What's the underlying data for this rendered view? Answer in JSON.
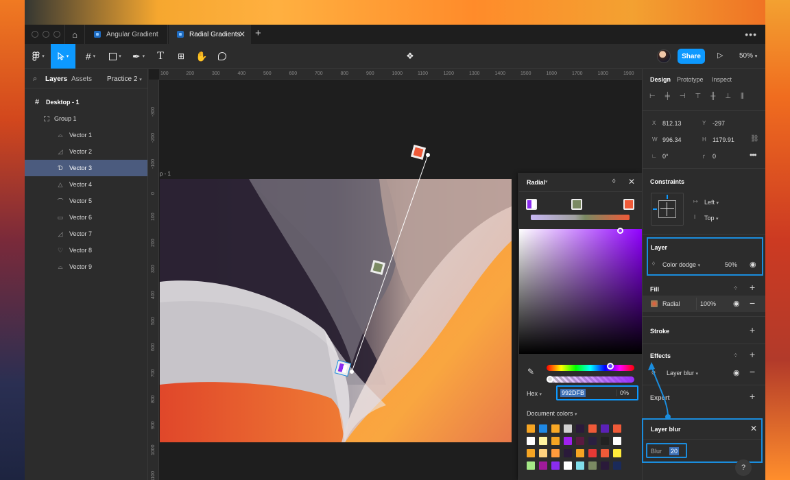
{
  "titlebar": {
    "tabs": [
      {
        "label": "Angular Gradient"
      },
      {
        "label": "Radial Gradients"
      }
    ],
    "close": "✕",
    "new_tab": "+",
    "more": "•••"
  },
  "toolbar": {
    "share_label": "Share",
    "zoom": "50%",
    "accent": "#0d99ff"
  },
  "layers_panel": {
    "tabs": {
      "layers": "Layers",
      "assets": "Assets",
      "page": "Practice 2"
    },
    "frame": "Desktop - 1",
    "group": "Group 1",
    "items": [
      "Vector 1",
      "Vector 2",
      "Vector 3",
      "Vector 4",
      "Vector 5",
      "Vector 6",
      "Vector 7",
      "Vector 8",
      "Vector 9"
    ],
    "selected": "Vector 3"
  },
  "canvas": {
    "frame_label": "p - 1",
    "ruler_h": [
      "100",
      "200",
      "300",
      "400",
      "500",
      "600",
      "700",
      "800",
      "900",
      "1000",
      "1100",
      "1200",
      "1300",
      "1400",
      "1500",
      "1600",
      "1700",
      "1800",
      "1900"
    ],
    "ruler_v": [
      "-300",
      "-200",
      "-100",
      "0",
      "100",
      "200",
      "300",
      "400",
      "500",
      "600",
      "700",
      "800",
      "900",
      "1000",
      "1100"
    ]
  },
  "picker": {
    "type": "Radial",
    "hex_label": "Hex",
    "hex_value": "992DFB",
    "opacity": "0%",
    "doc_colors_label": "Document colors",
    "stops": [
      "#8a2cf0",
      "#7b8a63",
      "#ef5a38"
    ],
    "swatches": [
      "#f6a523",
      "#1e88e5",
      "#f9a825",
      "#d0d0d0",
      "#2a1a3a",
      "#ef5a38",
      "#5b21b6",
      "#ef5a38",
      "#ffffff",
      "#fff3a0",
      "#f6a523",
      "#a020f0",
      "#5a1a40",
      "#2a2040",
      "#222222",
      "#ffffff",
      "#f6a523",
      "#ffd27f",
      "#ff9a3c",
      "#2a1a3a",
      "#f6a523",
      "#e53935",
      "#ef5a38",
      "#ffeb3b",
      "#a5e887",
      "#a01a9a",
      "#8a2cf0",
      "#ffffff",
      "#80deea",
      "#7b8a63",
      "#2a1a3a",
      "#1a2a5a"
    ]
  },
  "design_panel": {
    "tabs": {
      "design": "Design",
      "prototype": "Prototype",
      "inspect": "Inspect"
    },
    "x_label": "X",
    "x": "812.13",
    "y_label": "Y",
    "y": "-297",
    "w_label": "W",
    "w": "996.34",
    "h_label": "H",
    "h": "1179.91",
    "rotation": "0°",
    "radius": "0",
    "constraints_title": "Constraints",
    "constraint_h": "Left",
    "constraint_v": "Top",
    "layer_title": "Layer",
    "blend_mode": "Color dodge",
    "layer_opacity": "50%",
    "fill_title": "Fill",
    "fill_type": "Radial",
    "fill_opacity": "100%",
    "stroke_title": "Stroke",
    "effects_title": "Effects",
    "effect_name": "Layer blur",
    "export_title": "Export"
  },
  "blur_popup": {
    "title": "Layer blur",
    "blur_label": "Blur",
    "blur_value": "20"
  }
}
